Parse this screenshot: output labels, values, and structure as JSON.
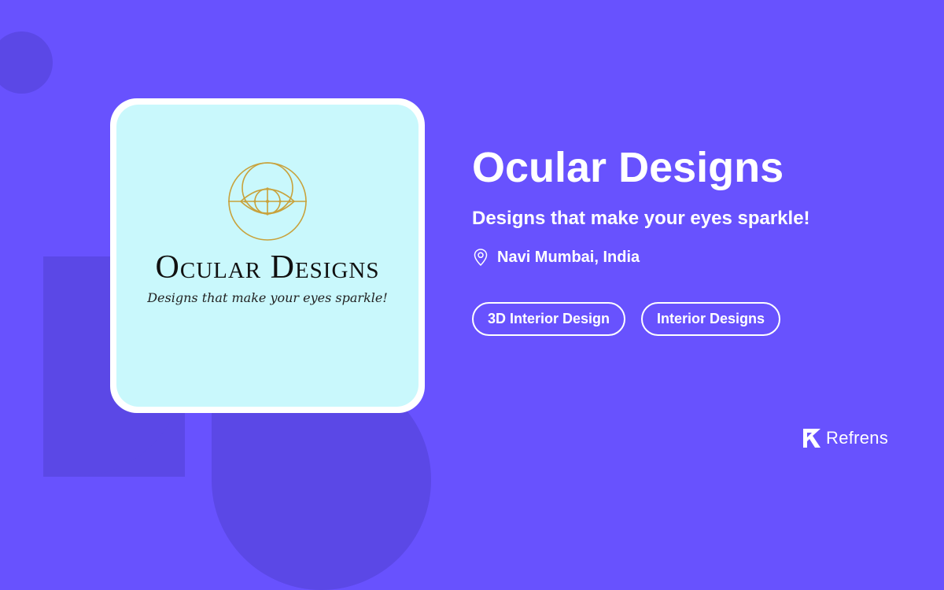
{
  "business": {
    "name": "Ocular Designs",
    "tagline": "Designs that make your eyes sparkle!",
    "location": "Navi Mumbai, India"
  },
  "logo": {
    "name": "Ocular Designs",
    "tagline": "Designs that make your eyes sparkle!",
    "mark_color": "#c8a23c",
    "background_color": "#c9f8fc"
  },
  "tags": [
    {
      "label": "3D Interior Design"
    },
    {
      "label": "Interior Designs"
    }
  ],
  "brand": {
    "name": "Refrens"
  },
  "icons": {
    "location": "location-pin-icon",
    "brand": "refrens-logo-icon"
  },
  "colors": {
    "background": "#6852fe",
    "decoration": "#5b48e6",
    "text": "#ffffff"
  }
}
